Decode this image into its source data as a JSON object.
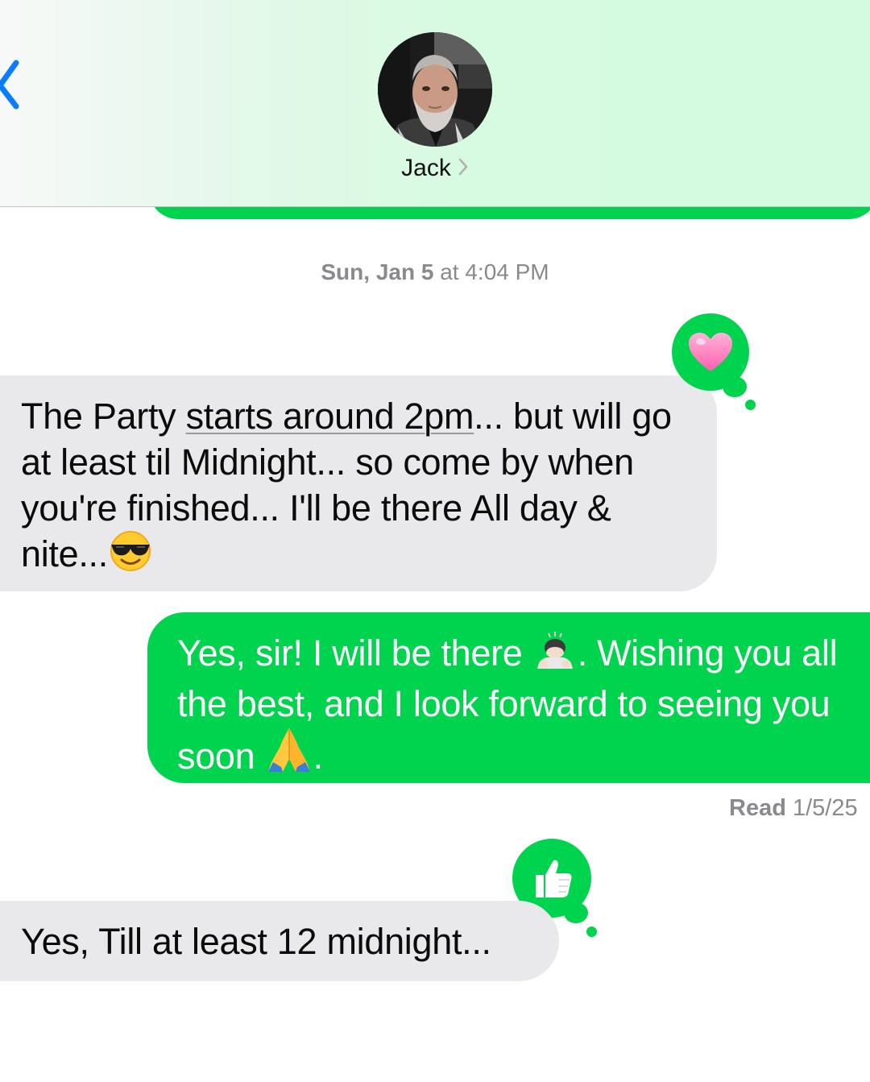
{
  "header": {
    "contact_name": "Jack",
    "background_accent": "#d4fbde",
    "back_icon": "chevron-left-icon",
    "name_icon": "chevron-right-icon"
  },
  "timestamp": {
    "day": "Sun, Jan 5",
    "connector": " at ",
    "time": "4:04 PM"
  },
  "messages": [
    {
      "direction": "incoming",
      "reaction": "heart",
      "text_a": "The Party ",
      "text_link": "starts around 2pm",
      "text_b": "... but will go at least til Midnight... so come by when you're finished... I'll be there All day & nite...",
      "emoji": "smiling-face-with-sunglasses"
    },
    {
      "direction": "outgoing",
      "text_a": "Yes, sir! I will be there ",
      "emoji_1": "person-bowing",
      "text_b": ". Wishing you all the best, and I look forward to seeing you soon ",
      "emoji_2": "folded-hands",
      "text_c": "."
    },
    {
      "direction": "incoming",
      "reaction": "thumbs-up",
      "text": "Yes, Till at least 12 midnight..."
    }
  ],
  "read_receipt": {
    "label": "Read",
    "date": "1/5/25"
  },
  "colors": {
    "imessage_green": "#00d34d",
    "incoming_gray": "#e9e9eb",
    "meta_gray": "#8a8a8e"
  }
}
